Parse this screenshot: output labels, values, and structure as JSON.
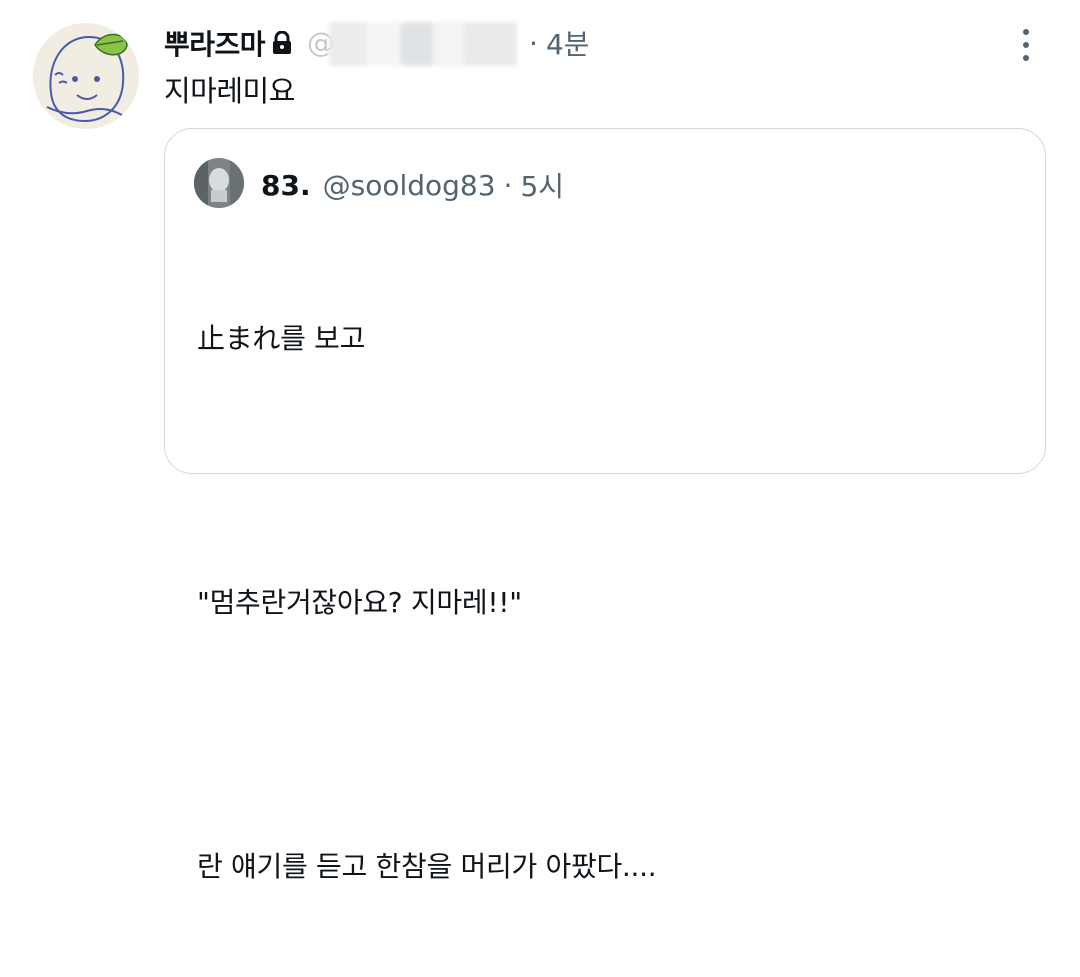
{
  "tweet": {
    "author": {
      "display_name": "뿌라즈마",
      "handle": "@",
      "protected_icon": "lock-icon"
    },
    "time": "4분",
    "text": "지마레미요",
    "more_icon": "vertical-ellipsis-icon"
  },
  "quote": {
    "author": {
      "display_name": "83.",
      "handle": "@sooldog83"
    },
    "time": "5시",
    "body_lines": [
      "止まれ를 보고",
      "",
      "\"멈추란거잖아요? 지마레!!\"",
      "",
      "란 얘기를 듣고 한참을 머리가 아팠다...."
    ]
  },
  "colors": {
    "text": "#0f1419",
    "secondary": "#536471",
    "border": "#cfd9de",
    "leaf": "#8bc34a"
  }
}
